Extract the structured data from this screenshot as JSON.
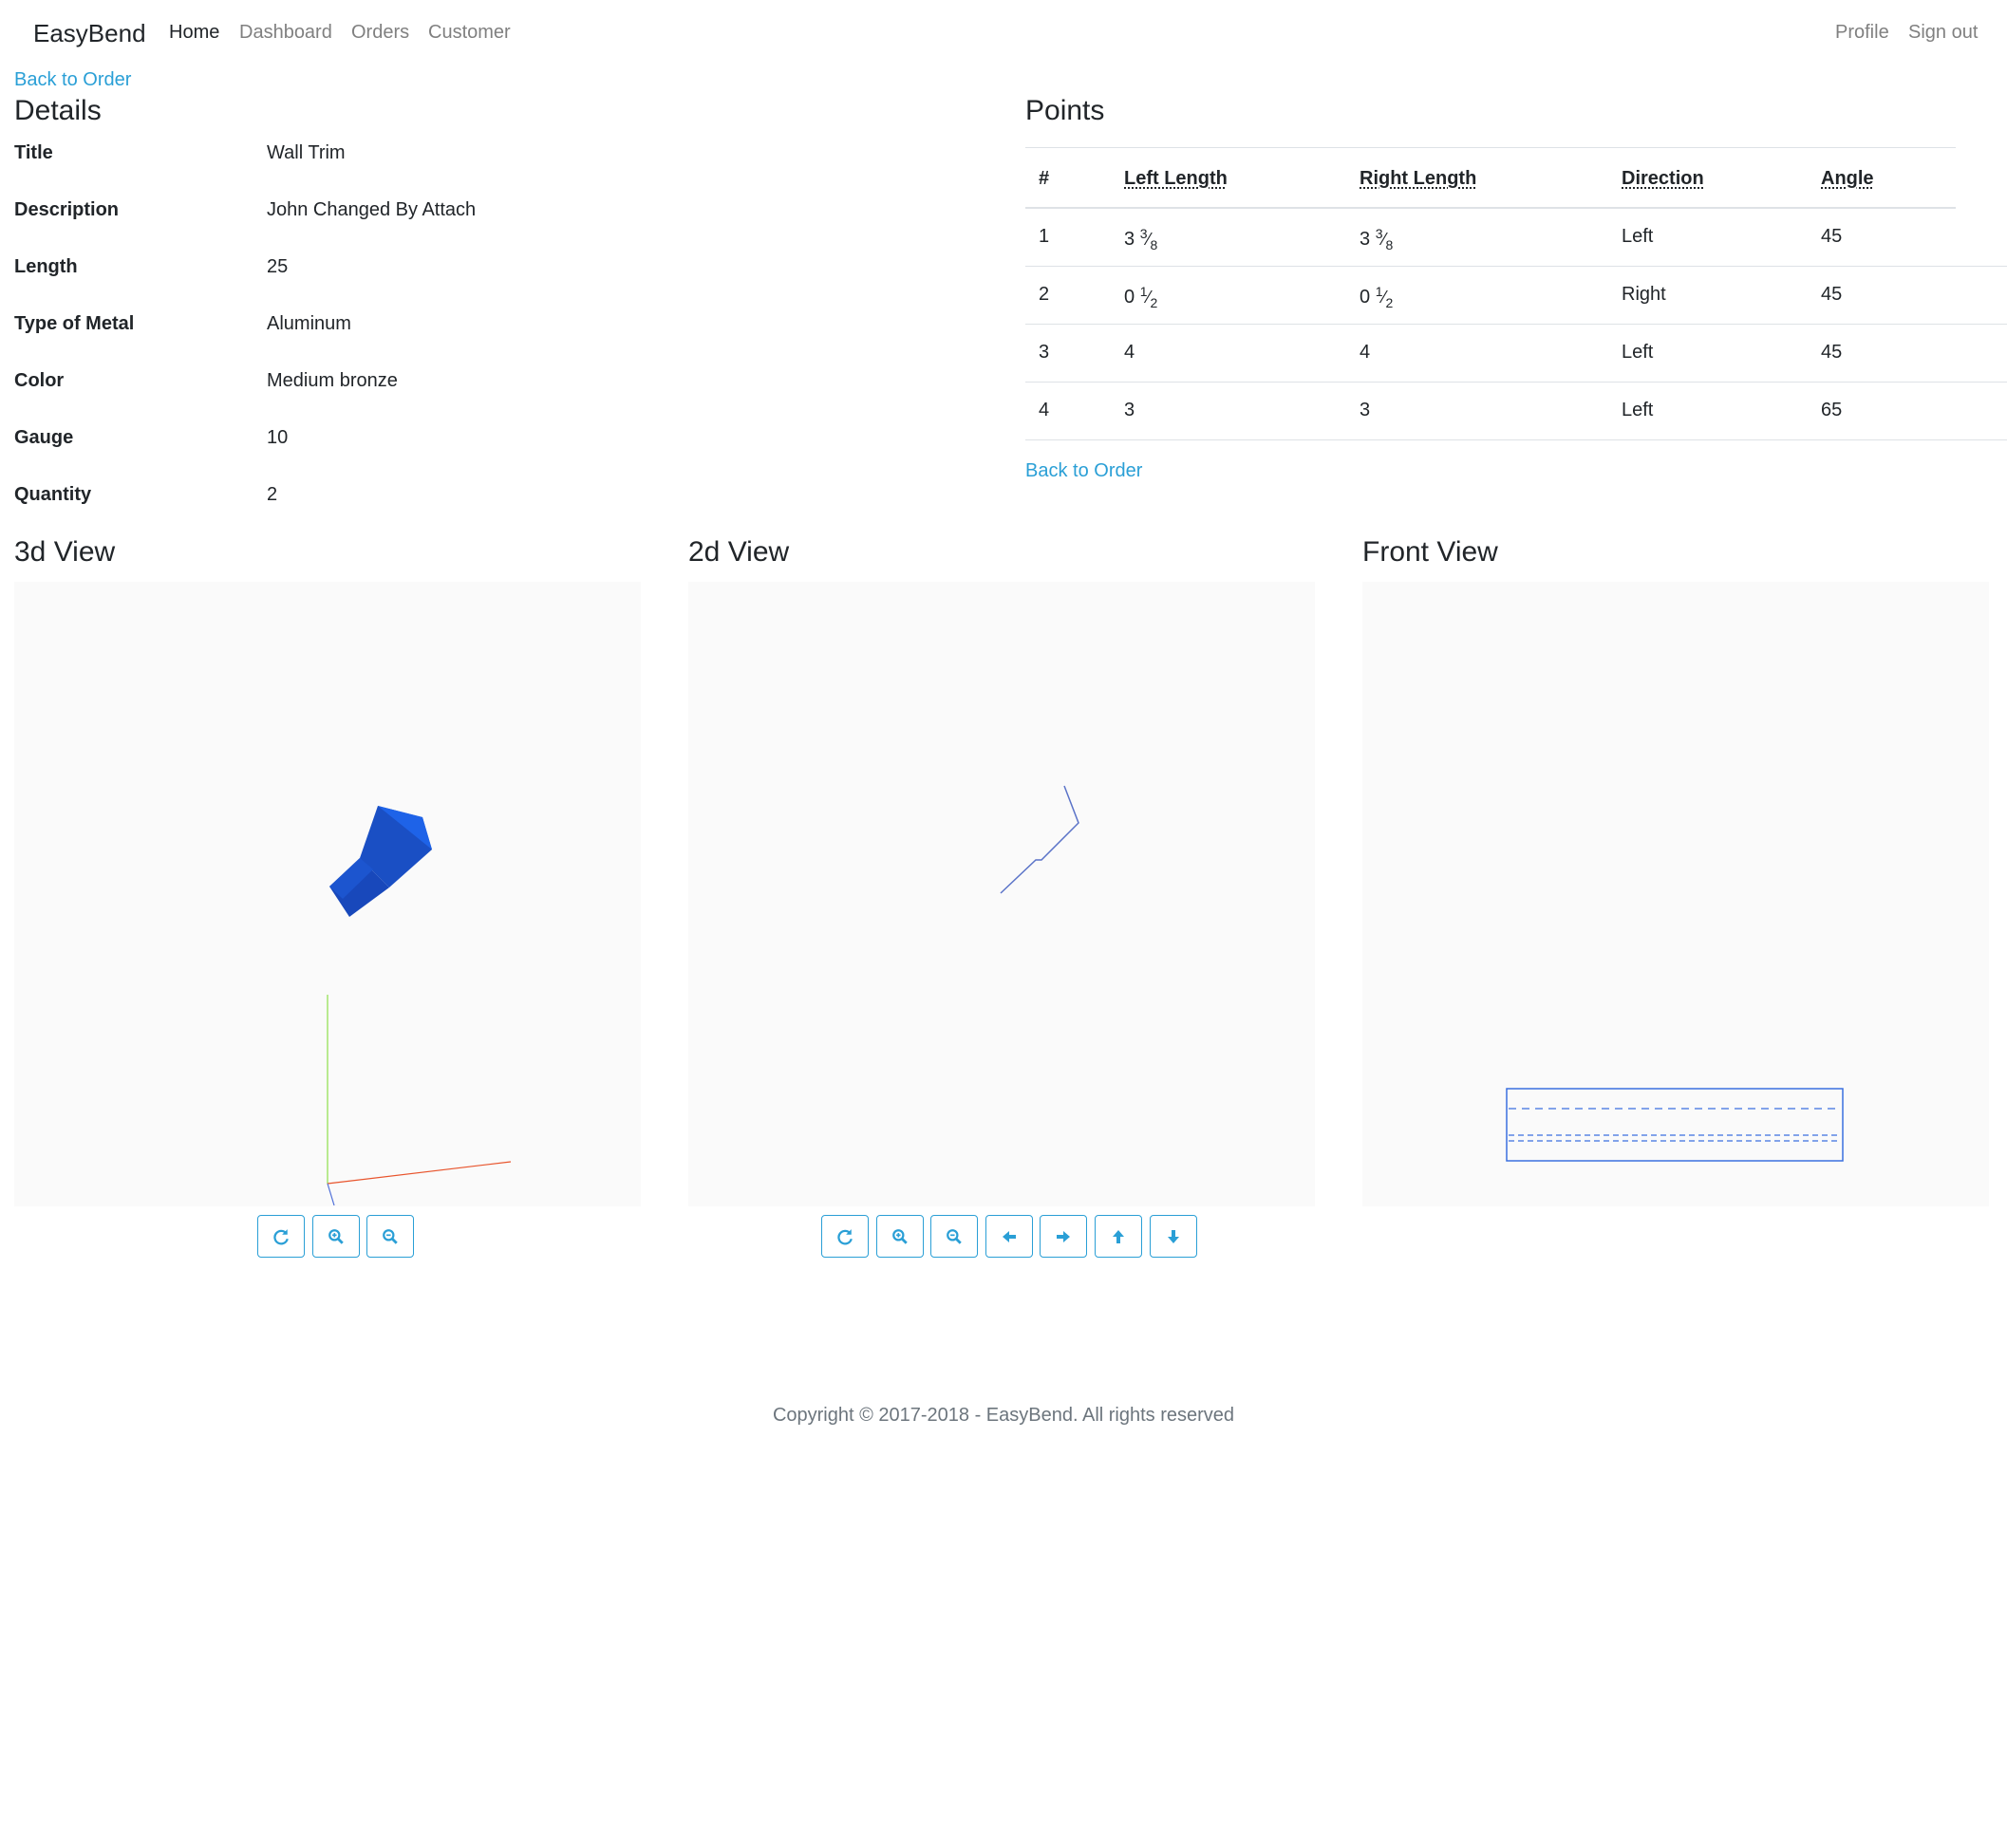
{
  "navbar": {
    "brand": "EasyBend",
    "links": [
      "Home",
      "Dashboard",
      "Orders",
      "Customer"
    ],
    "right_links": [
      "Profile",
      "Sign out"
    ]
  },
  "back_to_order": "Back to Order",
  "details": {
    "heading": "Details",
    "rows": [
      {
        "label": "Title",
        "value": "Wall Trim"
      },
      {
        "label": "Description",
        "value": "John Changed By Attach"
      },
      {
        "label": "Length",
        "value": "25"
      },
      {
        "label": "Type of Metal",
        "value": "Aluminum"
      },
      {
        "label": "Color",
        "value": "Medium bronze"
      },
      {
        "label": "Gauge",
        "value": "10"
      },
      {
        "label": "Quantity",
        "value": "2"
      }
    ]
  },
  "points": {
    "heading": "Points",
    "columns": [
      "#",
      "Left Length",
      "Right Length",
      "Direction",
      "Angle"
    ],
    "rows": [
      {
        "n": "1",
        "left_whole": "3",
        "left_num": "3",
        "left_den": "8",
        "right_whole": "3",
        "right_num": "3",
        "right_den": "8",
        "direction": "Left",
        "angle": "45"
      },
      {
        "n": "2",
        "left_whole": "0",
        "left_num": "1",
        "left_den": "2",
        "right_whole": "0",
        "right_num": "1",
        "right_den": "2",
        "direction": "Right",
        "angle": "45"
      },
      {
        "n": "3",
        "left_whole": "4",
        "left_num": "",
        "left_den": "",
        "right_whole": "4",
        "right_num": "",
        "right_den": "",
        "direction": "Left",
        "angle": "45"
      },
      {
        "n": "4",
        "left_whole": "3",
        "left_num": "",
        "left_den": "",
        "right_whole": "3",
        "right_num": "",
        "right_den": "",
        "direction": "Left",
        "angle": "65"
      }
    ]
  },
  "views": {
    "view3d_title": "3d View",
    "view2d_title": "2d View",
    "front_title": "Front View"
  },
  "colors": {
    "link": "#2a9fd6",
    "model_blue": "#1a5ad8",
    "axis_x": "#e8542c",
    "axis_y": "#8ee04a",
    "axis_z": "#4f6fd8"
  },
  "icons": {
    "view3d_controls": [
      "refresh-icon",
      "zoom-in-icon",
      "zoom-out-icon"
    ],
    "view2d_controls": [
      "refresh-icon",
      "zoom-in-icon",
      "zoom-out-icon",
      "arrow-left-icon",
      "arrow-right-icon",
      "arrow-up-icon",
      "arrow-down-icon"
    ]
  },
  "footer": "Copyright © 2017-2018 - EasyBend. All rights reserved"
}
